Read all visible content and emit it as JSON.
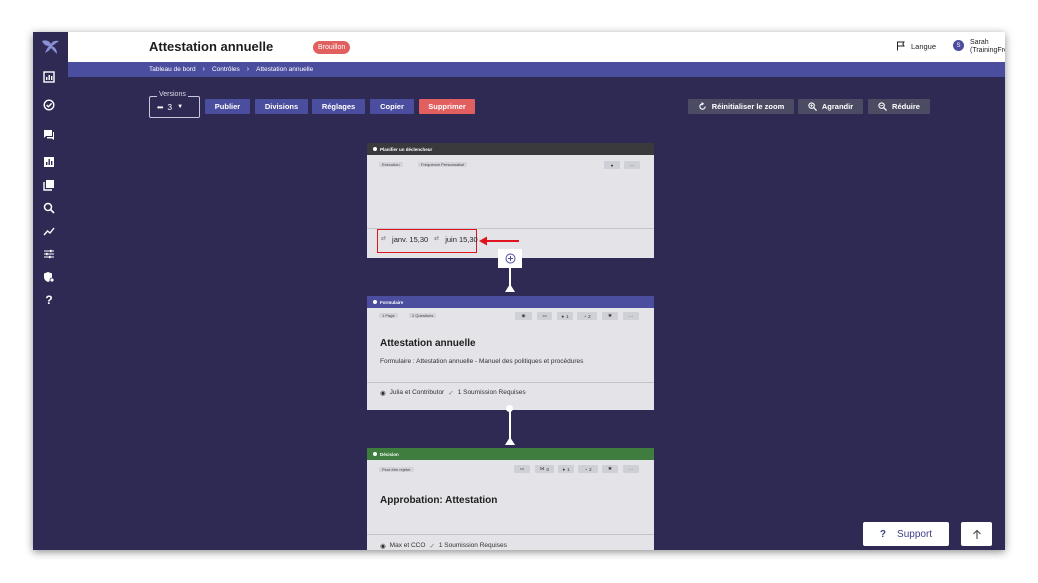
{
  "header": {
    "title": "Attestation annuelle",
    "badge": "Brouillon",
    "language": "Langue",
    "user_initial": "S",
    "user_name_line1": "Sarah",
    "user_name_line2": "(TrainingFrench)"
  },
  "breadcrumb": [
    "Tableau de bord",
    "Contrôles",
    "Attestation annuelle"
  ],
  "sidebar": {
    "icons": [
      "dashboard-icon",
      "check-circle-icon",
      "chat-icon",
      "bar-chart-icon",
      "library-icon",
      "search-icon",
      "trend-icon",
      "sliders-icon",
      "shield-settings-icon",
      "help-icon"
    ]
  },
  "toolbar": {
    "versions_label": "Versions",
    "versions_value": "3",
    "buttons": [
      "Publier",
      "Divisions",
      "Réglages",
      "Copier",
      "Supprimer"
    ],
    "zoom_reset": "Réinitialiser le zoom",
    "zoom_in": "Agrandir",
    "zoom_out": "Réduire"
  },
  "cards": {
    "trigger": {
      "header": "Planifier un déclencheur",
      "chip1": "Exécution",
      "chip2": "Fréquence Personnalisé",
      "date1": "janv. 15,30",
      "date2": "juin 15,30"
    },
    "form": {
      "header": "Formulaire",
      "chip1": "1 Page",
      "chip2": "2 Questions",
      "count1": "1",
      "count2": "2",
      "title": "Attestation annuelle",
      "subtitle": "Formulaire : Attestation annuelle - Manuel des politiques et procédures",
      "assignees": "Julia et Contributor",
      "submissions": "1 Soumission Requises"
    },
    "decision": {
      "header": "Décision",
      "chip1": "Peut être rejeter",
      "count0": "0",
      "count1": "1",
      "count2": "2",
      "title": "Approbation: Attestation",
      "assignees": "Max et CCO",
      "submissions": "1 Soumission Requises"
    }
  },
  "colors": {
    "background": "#2e2a54",
    "primary": "#4b4e9e",
    "danger": "#e25f5f",
    "trigger_header": "#3a3a3c",
    "decision_header": "#3e7d3e",
    "annotation": "#e0141e"
  },
  "support": {
    "label": "Support"
  }
}
